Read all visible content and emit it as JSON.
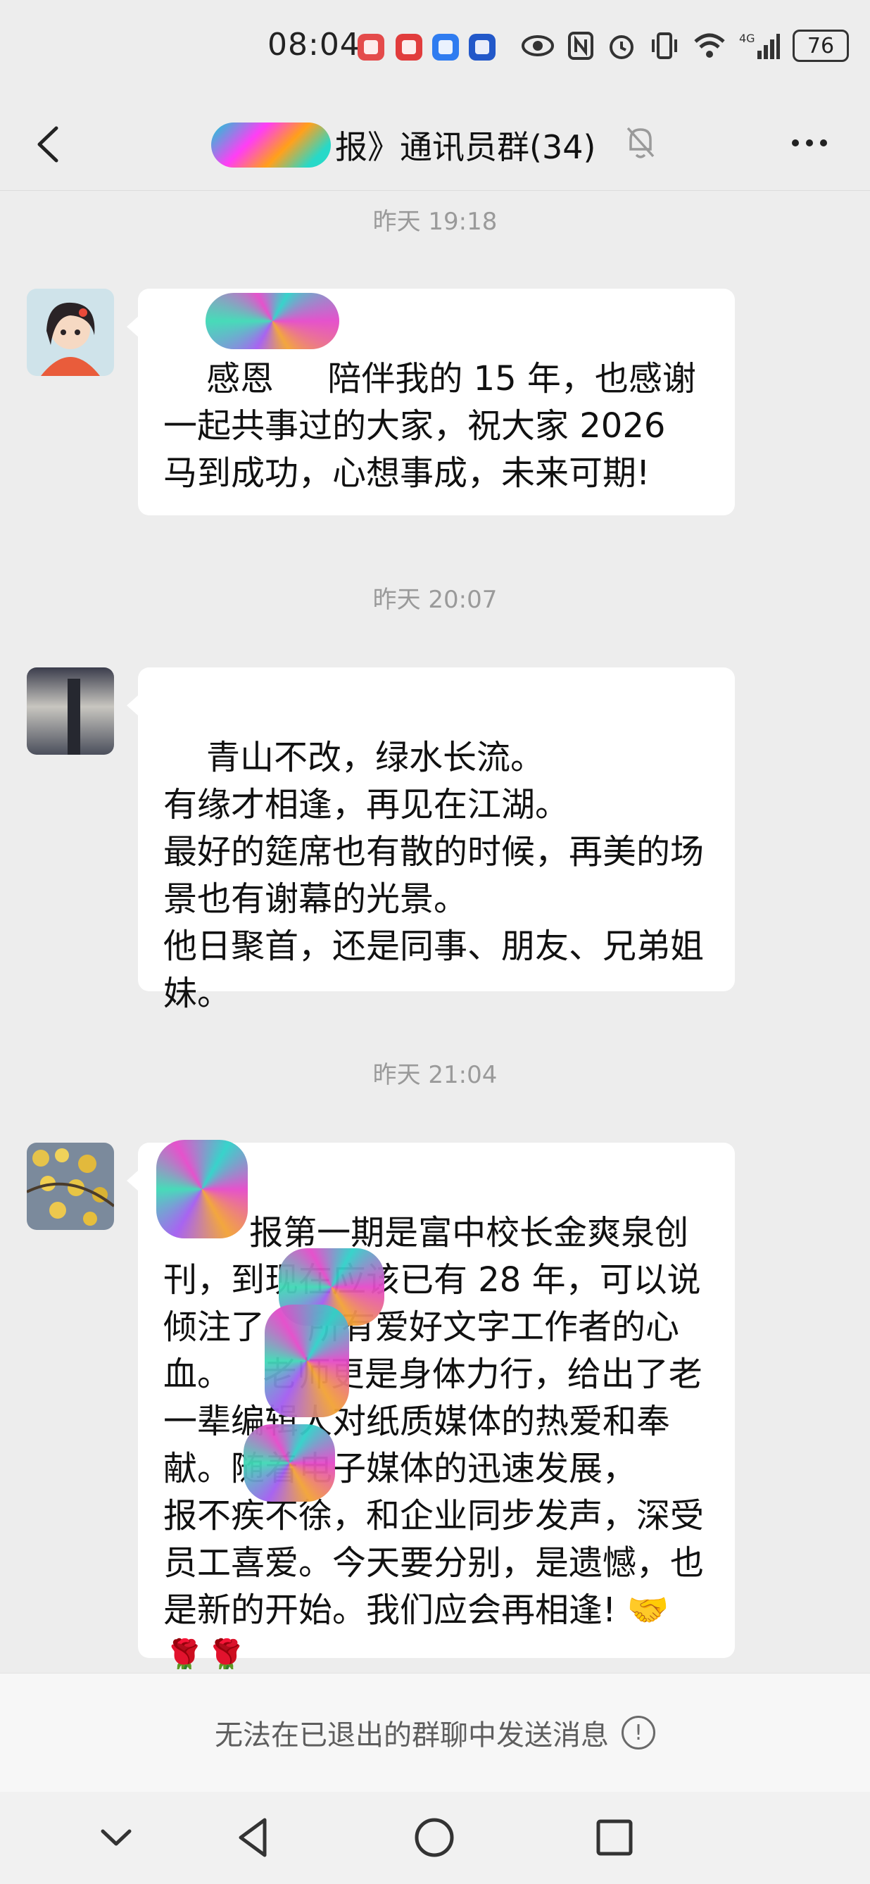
{
  "status_bar": {
    "time": "08:04",
    "battery": "76",
    "network": "4G"
  },
  "header": {
    "title": "报》通讯员群(34)"
  },
  "messages": [
    {
      "timestamp": "昨天 19:18",
      "text": "感恩     陪伴我的 15 年，也感谢一起共事过的大家，祝大家 2026 马到成功，心想事成，未来可期!"
    },
    {
      "timestamp": "昨天 20:07",
      "text": "青山不改，绿水长流。\n有缘才相逢，再见在江湖。\n最好的筵席也有散的时候，再美的场景也有谢幕的光景。\n他日聚首，还是同事、朋友、兄弟姐妹。"
    },
    {
      "timestamp": "昨天 21:04",
      "text": "    报第一期是富中校长金爽泉创刊，到现在应该已有 28 年，可以说倾注了    所有爱好文字工作者的心血。   老师更是身体力行，给出了老一辈编辑人对纸质媒体的热爱和奉献。随着电子媒体的迅速发展，    报不疾不徐，和企业同步发声，深受员工喜爱。今天要分别，是遗憾，也是新的开始。我们应会再相逢! 🤝🌹🌹"
    }
  ],
  "notice": {
    "text": "无法在已退出的群聊中发送消息"
  }
}
